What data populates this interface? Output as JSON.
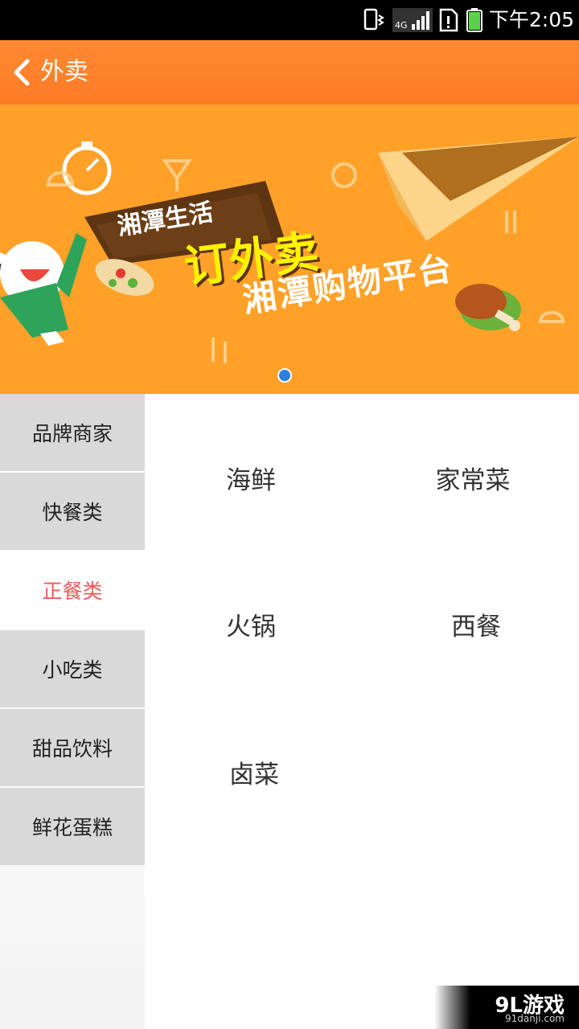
{
  "status_bar": {
    "time": "下午2:05",
    "network": "4G",
    "icons": [
      "vibrate-icon",
      "signal-4g-icon",
      "sim-alert-icon",
      "battery-icon"
    ]
  },
  "header": {
    "title": "外卖"
  },
  "banner": {
    "line1": "湘潭生活",
    "line2": "订外卖",
    "line3": "湘潭购物平台"
  },
  "sidebar": {
    "items": [
      {
        "label": "品牌商家",
        "active": false
      },
      {
        "label": "快餐类",
        "active": false
      },
      {
        "label": "正餐类",
        "active": true
      },
      {
        "label": "小吃类",
        "active": false
      },
      {
        "label": "甜品饮料",
        "active": false
      },
      {
        "label": "鲜花蛋糕",
        "active": false
      }
    ]
  },
  "categories": [
    {
      "label": "海鲜"
    },
    {
      "label": "家常菜"
    },
    {
      "label": "火锅"
    },
    {
      "label": "西餐"
    },
    {
      "label": "卤菜"
    }
  ],
  "watermark": {
    "logo": "9L游戏",
    "url": "91danji.com"
  },
  "colors": {
    "action_bar": "#ff7f2a",
    "banner_bg": "#ffa129",
    "active_text": "#f05a5a",
    "sidebar_bg": "#d9d9d9"
  }
}
